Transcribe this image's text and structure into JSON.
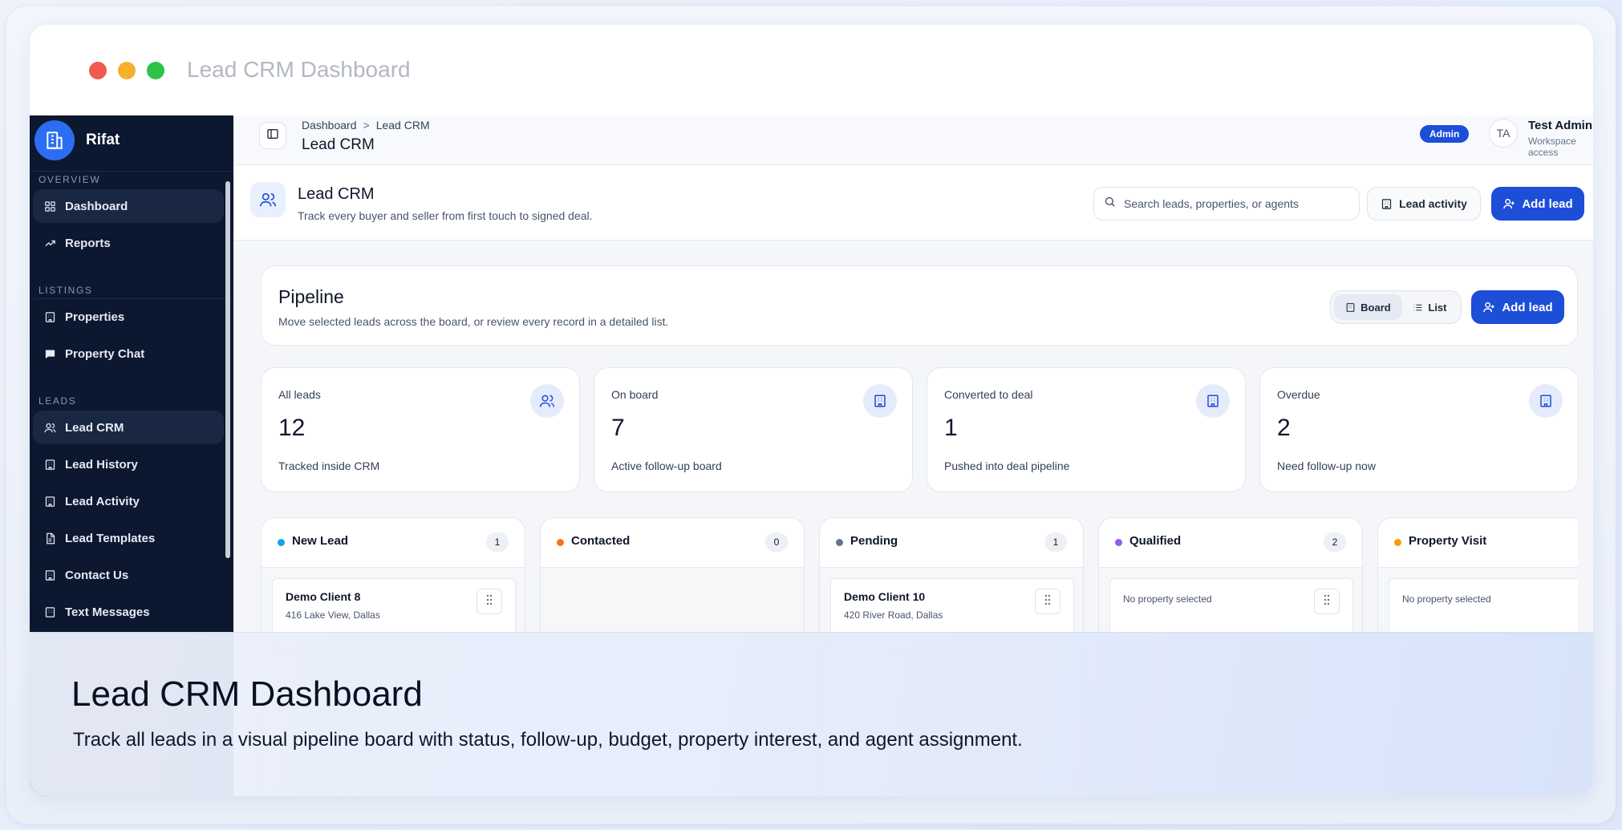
{
  "window": {
    "title": "Lead CRM Dashboard"
  },
  "sidebar": {
    "brand": "Rifat",
    "sections": [
      {
        "label": "OVERVIEW",
        "items": [
          {
            "label": "Dashboard",
            "icon": "grid-icon",
            "active": true
          },
          {
            "label": "Reports",
            "icon": "trend-icon",
            "active": false
          }
        ]
      },
      {
        "label": "LISTINGS",
        "items": [
          {
            "label": "Properties",
            "icon": "building-icon",
            "active": false
          },
          {
            "label": "Property Chat",
            "icon": "chat-icon",
            "active": false
          }
        ]
      },
      {
        "label": "LEADS",
        "items": [
          {
            "label": "Lead CRM",
            "icon": "users-icon",
            "active": true
          },
          {
            "label": "Lead History",
            "icon": "building-icon",
            "active": false
          },
          {
            "label": "Lead Activity",
            "icon": "building-icon",
            "active": false
          },
          {
            "label": "Lead Templates",
            "icon": "file-icon",
            "active": false
          },
          {
            "label": "Contact Us",
            "icon": "building-icon",
            "active": false
          },
          {
            "label": "Text Messages",
            "icon": "building-icon",
            "active": false
          }
        ]
      }
    ]
  },
  "header": {
    "breadcrumb": [
      "Dashboard",
      "Lead CRM"
    ],
    "breadcrumb_sep": ">",
    "title": "Lead CRM",
    "role_badge": "Admin",
    "user_initials": "TA",
    "user_name": "Test Admin",
    "user_sub": "Workspace access"
  },
  "page": {
    "title": "Lead CRM",
    "subtitle": "Track every buyer and seller from first touch to signed deal.",
    "search_placeholder": "Search leads, properties, or agents",
    "activity_button": "Lead activity",
    "add_button": "Add lead"
  },
  "pipeline": {
    "title": "Pipeline",
    "subtitle": "Move selected leads across the board, or review every record in a detailed list.",
    "view_board": "Board",
    "view_list": "List",
    "selected_view": "Board",
    "add_button": "Add lead"
  },
  "stats": [
    {
      "label": "All leads",
      "value": "12",
      "note": "Tracked inside CRM",
      "icon": "users-icon"
    },
    {
      "label": "On board",
      "value": "7",
      "note": "Active follow-up board",
      "icon": "building-icon"
    },
    {
      "label": "Converted to deal",
      "value": "1",
      "note": "Pushed into deal pipeline",
      "icon": "building-icon"
    },
    {
      "label": "Overdue",
      "value": "2",
      "note": "Need follow-up now",
      "icon": "building-icon"
    }
  ],
  "columns": [
    {
      "name": "New Lead",
      "count": "1",
      "color": "#0ea5e9",
      "card": {
        "title": "Demo Client 8",
        "sub": "416 Lake View, Dallas"
      }
    },
    {
      "name": "Contacted",
      "count": "0",
      "color": "#f97316",
      "card": null
    },
    {
      "name": "Pending",
      "count": "1",
      "color": "#64748b",
      "card": {
        "title": "Demo Client 10",
        "sub": "420 River Road, Dallas"
      }
    },
    {
      "name": "Qualified",
      "count": "2",
      "color": "#8b5cf6",
      "card": {
        "muted": "No property selected"
      }
    },
    {
      "name": "Property Visit",
      "count": "",
      "color": "#f59e0b",
      "card": {
        "muted": "No property selected"
      }
    }
  ],
  "caption": {
    "title": "Lead CRM Dashboard",
    "subtitle": "Track all leads in a visual pipeline board with status, follow-up, budget, property interest, and agent assignment."
  },
  "colors": {
    "primary": "#1d4ed8",
    "sidebar": "#0c1730"
  }
}
